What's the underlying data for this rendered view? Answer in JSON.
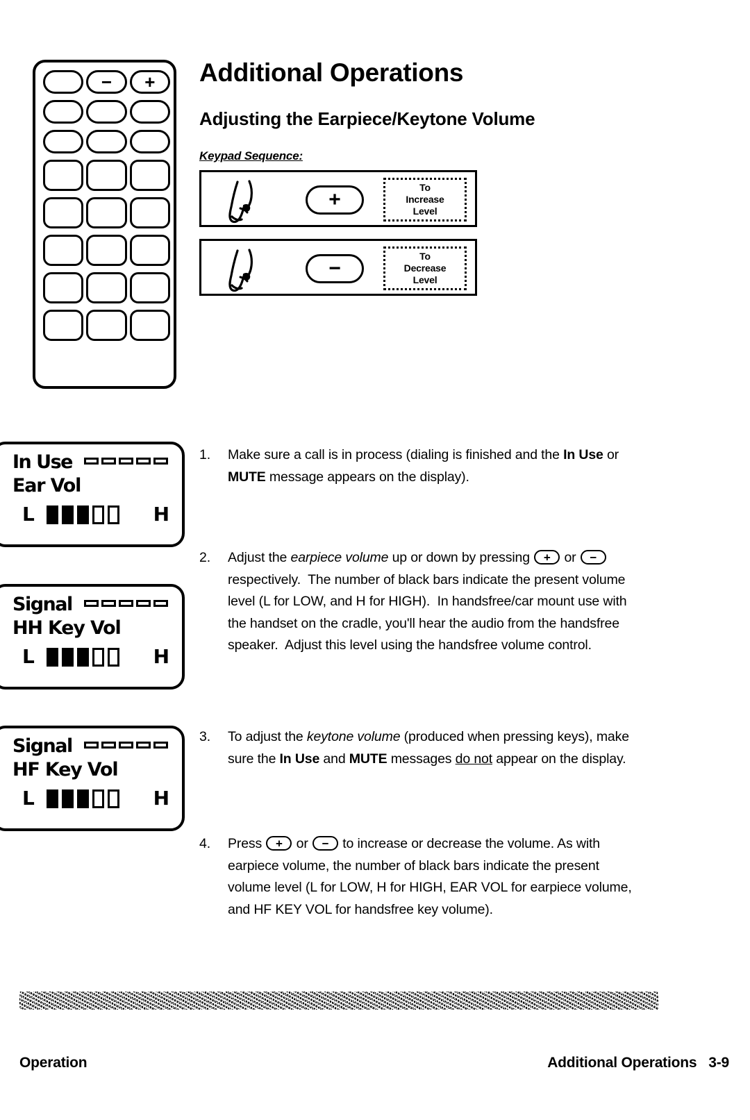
{
  "page": {
    "title": "Additional Operations",
    "section_title": "Adjusting the Earpiece/Keytone Volume",
    "keypad_sequence_label": "Keypad Sequence:"
  },
  "phone": {
    "keypad_rows": [
      {
        "type": "pill",
        "keys": [
          "",
          "−",
          "+"
        ]
      },
      {
        "type": "pill",
        "keys": [
          "",
          "",
          ""
        ]
      },
      {
        "type": "pill",
        "keys": [
          "",
          "",
          ""
        ]
      },
      {
        "type": "square",
        "keys": [
          "",
          "",
          ""
        ]
      },
      {
        "type": "square",
        "keys": [
          "",
          "",
          ""
        ]
      },
      {
        "type": "square",
        "keys": [
          "",
          "",
          ""
        ]
      },
      {
        "type": "square",
        "keys": [
          "",
          "",
          ""
        ]
      },
      {
        "type": "square",
        "keys": [
          "",
          "",
          ""
        ]
      }
    ]
  },
  "keypad_sequences": [
    {
      "key_glyph": "+",
      "note_lines": [
        "To",
        "Increase",
        "Level"
      ]
    },
    {
      "key_glyph": "−",
      "note_lines": [
        "To",
        "Decrease",
        "Level"
      ]
    }
  ],
  "lcd_panels": [
    {
      "status_label": "In Use",
      "signal_bars": 5,
      "mode_label": "Ear Vol",
      "low_label": "L",
      "high_label": "H",
      "volume_filled": 3,
      "volume_total": 5
    },
    {
      "status_label": "Signal",
      "signal_bars": 5,
      "mode_label": "HH Key Vol",
      "low_label": "L",
      "high_label": "H",
      "volume_filled": 3,
      "volume_total": 5
    },
    {
      "status_label": "Signal",
      "signal_bars": 5,
      "mode_label": "HF Key Vol",
      "low_label": "L",
      "high_label": "H",
      "volume_filled": 3,
      "volume_total": 5
    }
  ],
  "steps": [
    {
      "number": "1.",
      "text": "Make sure a call is in process (dialing is finished and the In Use or MUTE message appears on the display)."
    },
    {
      "number": "2.",
      "text": "Adjust the earpiece volume up or down by pressing (+) or (−) respectively.  The number of black bars indicate the present volume level (L for LOW, and H for HIGH).  In handsfree/car mount use with the handset on the cradle, you'll hear the audio from the handsfree speaker.  Adjust this level using the handsfree volume control."
    },
    {
      "number": "3.",
      "text": "To adjust the keytone volume (produced when pressing keys), make sure the In Use and MUTE messages do not appear on the display."
    },
    {
      "number": "4.",
      "text": "Press (+) or (−) to increase or decrease the volume.  As with earpiece volume, the number of black bars indicate the present volume level (L for LOW, H for HIGH, EAR VOL for earpiece volume, and HF KEY VOL for handsfree key volume)."
    }
  ],
  "footer": {
    "left": "Operation",
    "right": "Additional Operations   3-9"
  }
}
